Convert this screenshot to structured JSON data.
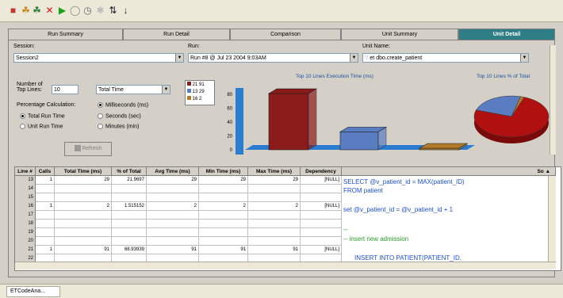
{
  "toolbar": {
    "icons": [
      "app-icon",
      "open-icon",
      "open-alt-icon",
      "delete-icon",
      "run-icon",
      "stop-icon",
      "clock-icon",
      "options-icon",
      "refresh-icon",
      "sort-icon"
    ]
  },
  "tabs": [
    {
      "label": "Run Summary",
      "active": false
    },
    {
      "label": "Run Detail",
      "active": false
    },
    {
      "label": "Comparison",
      "active": false
    },
    {
      "label": "Unit Summary",
      "active": false
    },
    {
      "label": "Unit Detail",
      "active": true
    }
  ],
  "filters": {
    "session_label": "Session:",
    "session_value": "Session2",
    "run_label": "Run:",
    "run_value": "Run #8 @ Jul 23 2004  9:03AM",
    "unit_label": "Unit Name:",
    "unit_value": "et dbo.create_patient"
  },
  "options": {
    "top_lines_label_1": "Number of",
    "top_lines_label_2": "Top Lines:",
    "top_lines_value": "10",
    "metric_value": "Total Time",
    "pct_calc_label": "Percentage Calculation:",
    "pct_total": "Total Run Time",
    "pct_unit": "Unit Run Time",
    "unit_ms": "Milliseconds (ms)",
    "unit_sec": "Seconds (sec)",
    "unit_min": "Minutes (min)",
    "refresh_label": "Refresh"
  },
  "legend": [
    "21  91",
    "13  29",
    "16    2"
  ],
  "chart_data": [
    {
      "type": "bar",
      "title": "Top 10 Lines Execution Time (ms)",
      "categories": [
        "21",
        "13",
        "16"
      ],
      "values": [
        91,
        29,
        2
      ],
      "colors": [
        "#8b1a1a",
        "#5a7cc0",
        "#b07a2a"
      ],
      "ylim": [
        0,
        100
      ],
      "yticks": [
        "80",
        "60",
        "40",
        "20",
        "0"
      ]
    },
    {
      "type": "pie",
      "title": "Top 10 Lines % of Total",
      "categories": [
        "21",
        "13",
        "16"
      ],
      "values": [
        91,
        29,
        2
      ],
      "colors": [
        "#b01010",
        "#5a7cc0",
        "#b07a2a"
      ]
    }
  ],
  "grid": {
    "headers": [
      "Line #",
      "Calls",
      "Total Time (ms)",
      "% of Total",
      "Avg Time (ms)",
      "Min Time (ms)",
      "Max Time (ms)",
      "Dependency"
    ],
    "source_header": "So",
    "rows": [
      {
        "line": "13",
        "calls": "1",
        "total": "29",
        "pct": "21.9697",
        "avg": "29",
        "min": "29",
        "max": "29",
        "dep": "[NULL]"
      },
      {
        "line": "14",
        "calls": "",
        "total": "",
        "pct": "",
        "avg": "",
        "min": "",
        "max": "",
        "dep": ""
      },
      {
        "line": "15",
        "calls": "",
        "total": "",
        "pct": "",
        "avg": "",
        "min": "",
        "max": "",
        "dep": ""
      },
      {
        "line": "16",
        "calls": "1",
        "total": "2",
        "pct": "1.515152",
        "avg": "2",
        "min": "2",
        "max": "2",
        "dep": "[NULL]"
      },
      {
        "line": "17",
        "calls": "",
        "total": "",
        "pct": "",
        "avg": "",
        "min": "",
        "max": "",
        "dep": ""
      },
      {
        "line": "18",
        "calls": "",
        "total": "",
        "pct": "",
        "avg": "",
        "min": "",
        "max": "",
        "dep": ""
      },
      {
        "line": "19",
        "calls": "",
        "total": "",
        "pct": "",
        "avg": "",
        "min": "",
        "max": "",
        "dep": ""
      },
      {
        "line": "20",
        "calls": "",
        "total": "",
        "pct": "",
        "avg": "",
        "min": "",
        "max": "",
        "dep": ""
      },
      {
        "line": "21",
        "calls": "1",
        "total": "91",
        "pct": "68.93939",
        "avg": "91",
        "min": "91",
        "max": "91",
        "dep": "[NULL]"
      },
      {
        "line": "22",
        "calls": "",
        "total": "",
        "pct": "",
        "avg": "",
        "min": "",
        "max": "",
        "dep": ""
      }
    ],
    "code": [
      {
        "text": "SELECT @v_patient_id = MAX(patient_ID)",
        "style": "kw"
      },
      {
        "text": "FROM patient",
        "style": "kw"
      },
      {
        "text": "set @v_patient_id = @v_patient_id + 1",
        "style": "kw"
      },
      {
        "text": "--",
        "style": "cm"
      },
      {
        "text": "-- insert new admission",
        "style": "cm"
      },
      {
        "text": "INSERT INTO PATIENT(PATIENT_ID,",
        "style": "kw"
      }
    ]
  },
  "status": {
    "task_label": "ETCodeAna..."
  }
}
